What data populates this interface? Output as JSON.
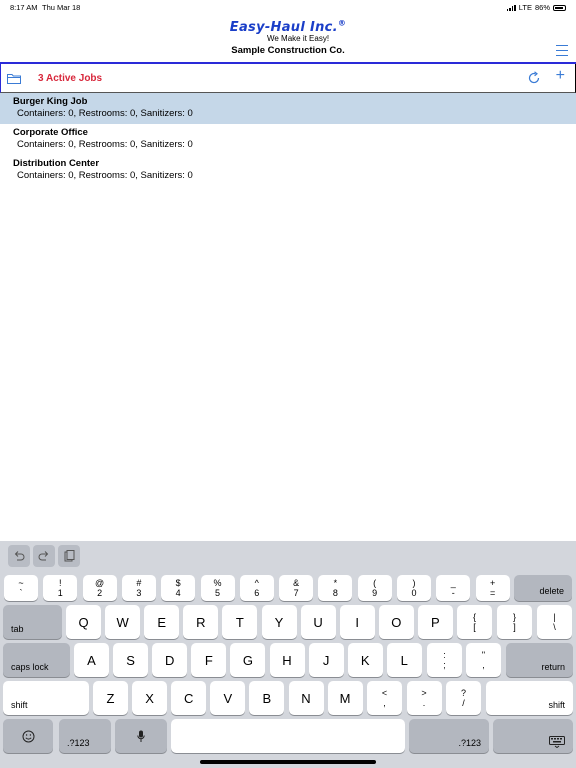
{
  "status_bar": {
    "time": "8:17 AM",
    "date": "Thu Mar 18",
    "network": "LTE",
    "battery": "86%"
  },
  "header": {
    "logo": "Easy-Haul Inc.",
    "logo_mark": "®",
    "tagline": "We Make it Easy!",
    "company": "Sample Construction Co."
  },
  "toolbar": {
    "active_jobs_label": "3 Active Jobs"
  },
  "jobs": [
    {
      "name": "Burger King Job",
      "detail": "Containers: 0, Restrooms: 0, Sanitizers: 0",
      "selected": true
    },
    {
      "name": "Corporate Office",
      "detail": "Containers: 0, Restrooms: 0, Sanitizers: 0",
      "selected": false
    },
    {
      "name": "Distribution Center",
      "detail": "Containers: 0, Restrooms: 0, Sanitizers: 0",
      "selected": false
    }
  ],
  "keyboard": {
    "number_row": [
      {
        "top": "~",
        "bottom": "`"
      },
      {
        "top": "!",
        "bottom": "1"
      },
      {
        "top": "@",
        "bottom": "2"
      },
      {
        "top": "#",
        "bottom": "3"
      },
      {
        "top": "$",
        "bottom": "4"
      },
      {
        "top": "%",
        "bottom": "5"
      },
      {
        "top": "^",
        "bottom": "6"
      },
      {
        "top": "&",
        "bottom": "7"
      },
      {
        "top": "*",
        "bottom": "8"
      },
      {
        "top": "(",
        "bottom": "9"
      },
      {
        "top": ")",
        "bottom": "0"
      },
      {
        "top": "_",
        "bottom": "-"
      },
      {
        "top": "+",
        "bottom": "="
      }
    ],
    "delete_label": "delete",
    "tab_label": "tab",
    "row_q": [
      "Q",
      "W",
      "E",
      "R",
      "T",
      "Y",
      "U",
      "I",
      "O",
      "P"
    ],
    "row_q_extra": [
      {
        "top": "{",
        "bottom": "["
      },
      {
        "top": "}",
        "bottom": "]"
      },
      {
        "top": "|",
        "bottom": "\\"
      }
    ],
    "caps_label": "caps lock",
    "row_a": [
      "A",
      "S",
      "D",
      "F",
      "G",
      "H",
      "J",
      "K",
      "L"
    ],
    "row_a_extra": [
      {
        "top": ":",
        "bottom": ";"
      },
      {
        "top": "\"",
        "bottom": ","
      }
    ],
    "return_label": "return",
    "shift_label": "shift",
    "row_z": [
      "Z",
      "X",
      "C",
      "V",
      "B",
      "N",
      "M"
    ],
    "row_z_extra": [
      {
        "top": "<",
        "bottom": ","
      },
      {
        "top": ">",
        "bottom": "."
      },
      {
        "top": "?",
        "bottom": "/"
      }
    ],
    "numbers_label": ".?123"
  },
  "colors": {
    "brand": "#1a3ec8",
    "accent": "#3a7bd5",
    "active_jobs": "#d8283c",
    "selected_row": "#c5d7e8"
  },
  "icons": [
    "folder-icon",
    "refresh-icon",
    "plus-icon",
    "hamburger-menu-icon",
    "undo-icon",
    "redo-icon",
    "paste-icon",
    "emoji-icon",
    "microphone-icon",
    "keyboard-dismiss-icon"
  ]
}
